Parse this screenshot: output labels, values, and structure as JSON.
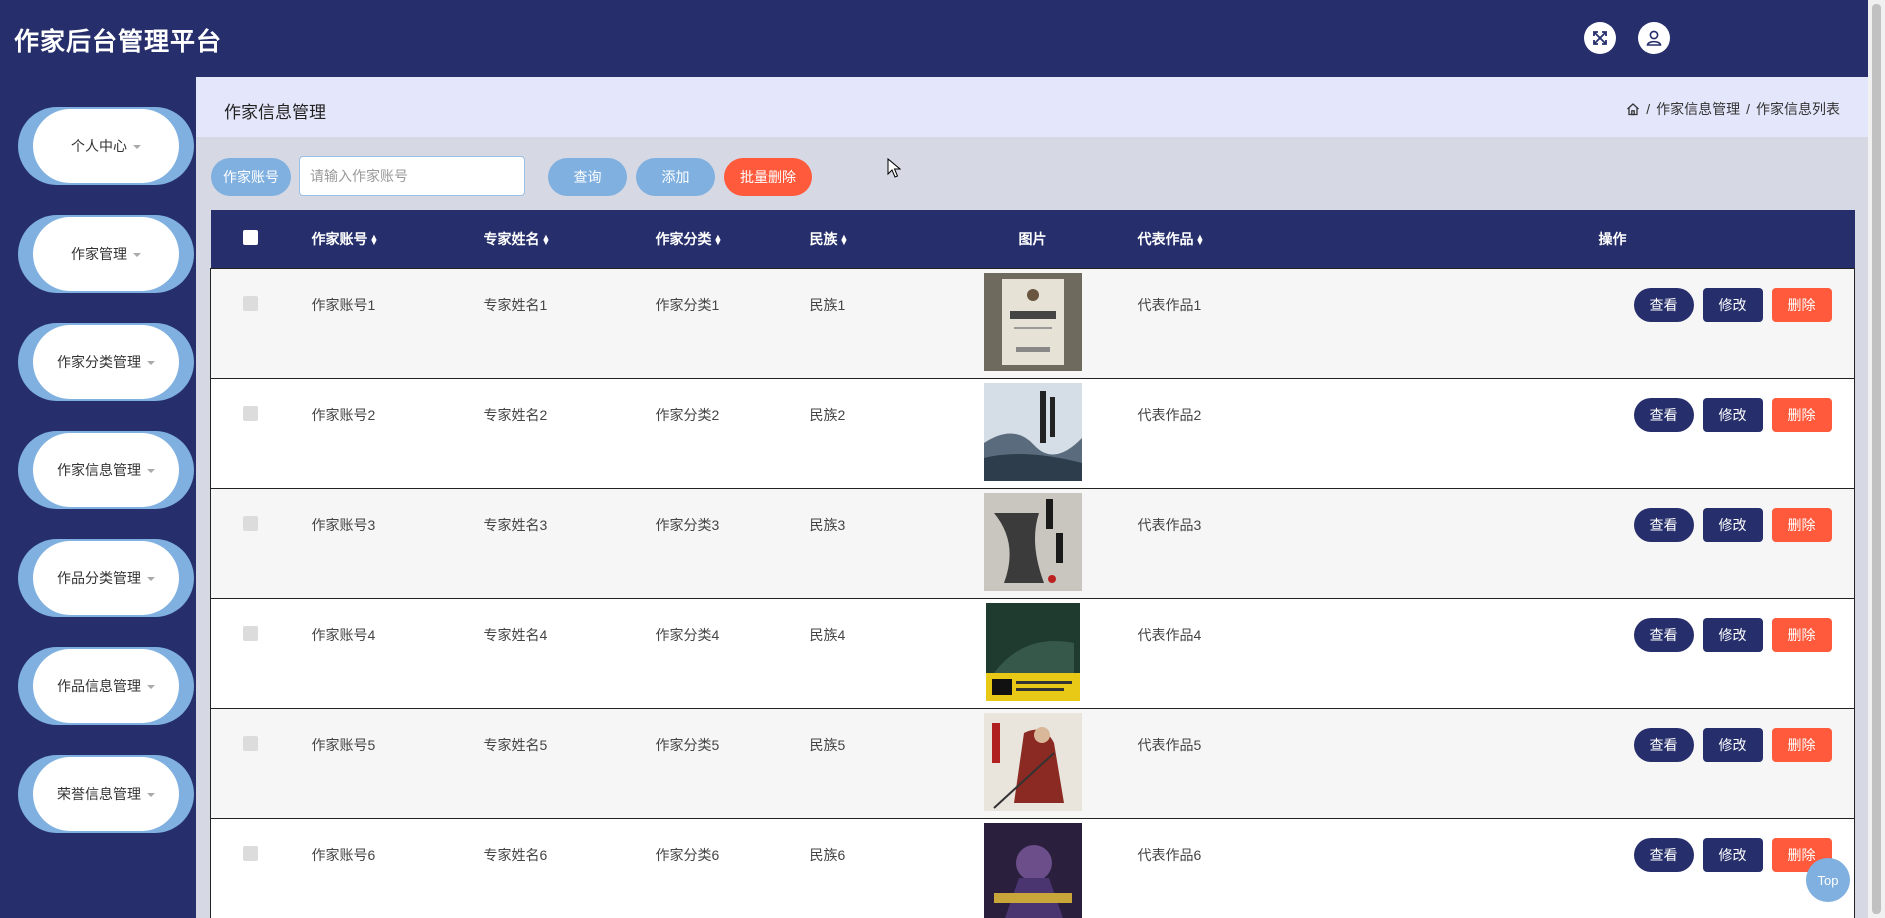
{
  "app": {
    "title": "作家后台管理平台"
  },
  "header_icons": [
    "fullscreen-icon",
    "user-icon"
  ],
  "sidebar": {
    "items": [
      {
        "label": "个人中心"
      },
      {
        "label": "作家管理"
      },
      {
        "label": "作家分类管理"
      },
      {
        "label": "作家信息管理"
      },
      {
        "label": "作品分类管理"
      },
      {
        "label": "作品信息管理"
      },
      {
        "label": "荣誉信息管理"
      }
    ]
  },
  "page": {
    "title": "作家信息管理",
    "breadcrumb": {
      "home_icon": "home-icon",
      "sep": "/",
      "level1": "作家信息管理",
      "level2": "作家信息列表"
    }
  },
  "search": {
    "field_label": "作家账号",
    "placeholder": "请输入作家账号",
    "value": "",
    "query_label": "查询",
    "add_label": "添加",
    "batch_delete_label": "批量删除"
  },
  "table": {
    "headers": {
      "account": "作家账号",
      "name": "专家姓名",
      "category": "作家分类",
      "ethnicity": "民族",
      "image": "图片",
      "work": "代表作品",
      "actions": "操作"
    },
    "rows": [
      {
        "account": "作家账号1",
        "name": "专家姓名1",
        "category": "作家分类1",
        "ethnicity": "民族1",
        "work": "代表作品1"
      },
      {
        "account": "作家账号2",
        "name": "专家姓名2",
        "category": "作家分类2",
        "ethnicity": "民族2",
        "work": "代表作品2"
      },
      {
        "account": "作家账号3",
        "name": "专家姓名3",
        "category": "作家分类3",
        "ethnicity": "民族3",
        "work": "代表作品3"
      },
      {
        "account": "作家账号4",
        "name": "专家姓名4",
        "category": "作家分类4",
        "ethnicity": "民族4",
        "work": "代表作品4"
      },
      {
        "account": "作家账号5",
        "name": "专家姓名5",
        "category": "作家分类5",
        "ethnicity": "民族5",
        "work": "代表作品5"
      },
      {
        "account": "作家账号6",
        "name": "专家姓名6",
        "category": "作家分类6",
        "ethnicity": "民族6",
        "work": "代表作品6"
      }
    ],
    "actions": {
      "view": "查看",
      "edit": "修改",
      "delete": "删除"
    }
  },
  "top_button": {
    "label": "Top"
  },
  "colors": {
    "navy": "#262f6b",
    "light_blue": "#7fb0e0",
    "danger": "#ff5a3c",
    "crumb_bg": "#e4e7fb"
  }
}
